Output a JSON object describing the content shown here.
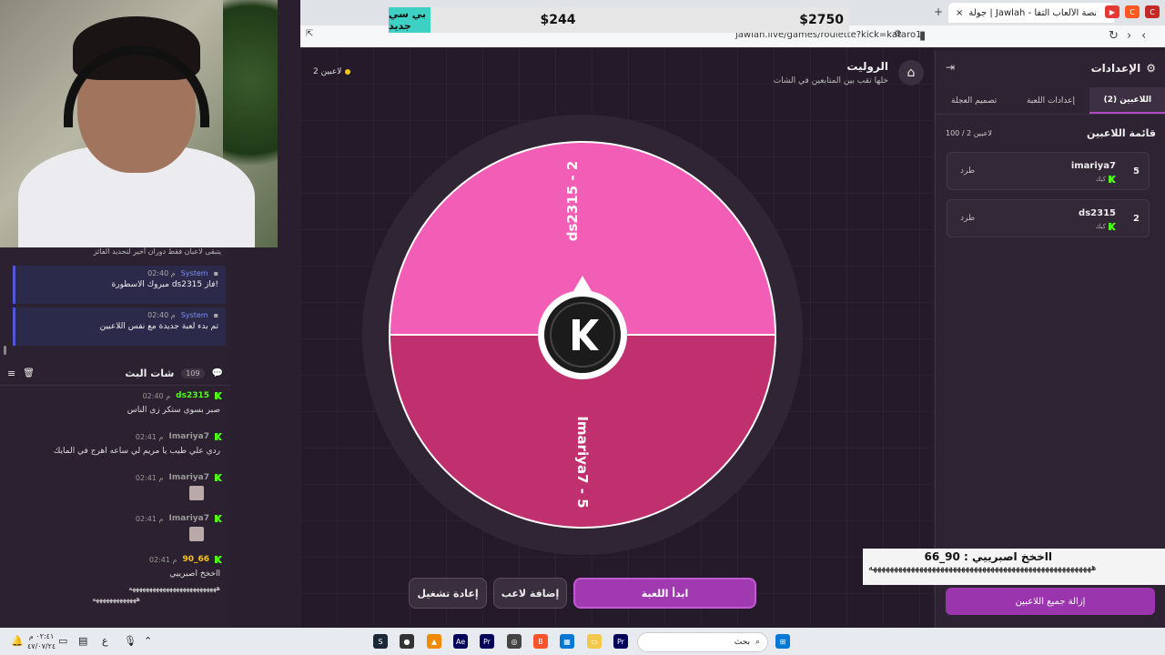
{
  "browser": {
    "tab_title": "جولة | Jawlah - منصة الألعاب التفا",
    "tab_close": "×",
    "new_tab": "+",
    "other_tab_label": "جولة",
    "url": "jawlah.live/games/roulette?kick=kataro1"
  },
  "donation": {
    "badge": "بي سي جديد",
    "current": "$244",
    "goal": "$2750"
  },
  "left_chat": {
    "partial_message": "يتبقى لاعبان فقط دوران أخير لتحديد الفائز",
    "system_messages": [
      {
        "name": "System",
        "time": "02:40 م",
        "text": "مبروك الاسطورة ds2315 فاز!"
      },
      {
        "name": "System",
        "time": "02:40 م",
        "text": "تم بدء لعبة جديدة مع نفس اللاعبين"
      }
    ],
    "header": {
      "title": "شات البث",
      "count": "109"
    },
    "messages": [
      {
        "user": "ds2315",
        "time": "02:40 م",
        "text": "صبر بسوي ستكر زي الناس",
        "user_color": "#53fc18"
      },
      {
        "user": "Imariya7",
        "time": "02:41 م",
        "text": "ردي علي طيب يا مريم لي ساعه اهرج في المايك",
        "user_color": "#eeeeee"
      },
      {
        "user": "Imariya7",
        "time": "02:41 م",
        "text": "",
        "user_color": "#eeeeee"
      },
      {
        "user": "Imariya7",
        "time": "02:41 م",
        "text": "",
        "user_color": "#eeeeee"
      },
      {
        "user": "90_66",
        "time": "02:41 م",
        "text": "ااخخخ اصبرييي",
        "user_color": "#f5c518"
      }
    ],
    "spam_line1": "ههههههههههههههههههههههههههه",
    "spam_line2": "هههههههههههههه"
  },
  "game": {
    "title": "الروليت",
    "subtitle": "خلها تقب بين المتابعين في الشات",
    "players_indicator": "2 لاعبين",
    "wheel_segments": [
      {
        "label": "ds2315 - 2",
        "color": "#f25db6"
      },
      {
        "label": "Imariya7 - 5",
        "color": "#c0306f"
      }
    ],
    "buttons": {
      "start": "ابدأ اللعبة",
      "add_player": "إضافة لاعب",
      "replay": "إعادة تشغيل"
    }
  },
  "settings": {
    "title": "الإعدادات",
    "tabs": [
      "اللاعبين (2)",
      "إعدادات اللعبة",
      "تصميم العجلة"
    ],
    "list_title": "قائمة اللاعبين",
    "list_count": "100 / 2 لاعبين",
    "players": [
      {
        "rank": "5",
        "name": "imariya7",
        "platform": "كيك",
        "kick_label": "طرد"
      },
      {
        "rank": "2",
        "name": "ds2315",
        "platform": "كيك",
        "kick_label": "طرد"
      }
    ],
    "remove_all": "إزالة جميع اللاعبين"
  },
  "overlay_chat": {
    "text": "ااخخخ اصبرييي : 90_66",
    "spam": "هههههههههههههههههههههههههههههههههههههههههههههههههههههه"
  },
  "taskbar": {
    "search_placeholder": "بحث",
    "time": "٠٢:٤١ م",
    "date": "٤٧/٠٧/٢٤",
    "lang": "ع"
  }
}
